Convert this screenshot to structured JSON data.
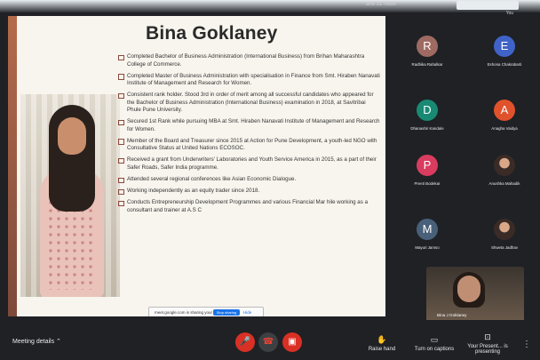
{
  "top": {
    "info": "and 31 more",
    "chip": "",
    "caption": "You"
  },
  "slide": {
    "title": "Bina Goklaney",
    "bullets": [
      "Completed Bachelor of Business Administration (International Business) from Brihan Maharashtra College of Commerce.",
      "Completed Master of Business Administration with specialisation in Finance from Smt. Hiraben Nanavati Institute of Management and Research for Women.",
      "Consistent rank holder. Stood 3rd in order of merit among all successful candidates who appeared for the Bachelor of Business Administration (International Business) examination in 2018, at Savitribai Phule Pune University.",
      "Secured 1st Rank while pursuing MBA at Smt. Hiraben Nanavati Institute of Management and Research for Women.",
      "Member of the Board and Treasurer since 2015 at Action for Pune Development, a youth-led NGO with Consultative Status at United Nations ECOSOC.",
      "Received a grant from Underwriters' Laboratories and Youth Service America in 2015, as a part of their Safer Roads, Safer India programme.",
      "Attended several regional conferences like Asian Economic Dialogue.",
      "Working independently as an equity trader since 2018.",
      "Conducts Entrepreneurship Development Programmes and various Financial Mar                    hile working as a consultant and trainer at A.S C"
    ]
  },
  "share_bar": {
    "text": "meet.google.com is sharing your screen.",
    "stop_label": "Stop sharing",
    "hide_label": "Hide"
  },
  "participants": [
    {
      "name": "Radhika Rahalkar",
      "initial": "R",
      "color": "#9e6a62"
    },
    {
      "name": "Eshona Chakrabarti",
      "initial": "E",
      "color": "#3f63c7"
    },
    {
      "name": "Dhanashri Kandale",
      "initial": "D",
      "color": "#188a73"
    },
    {
      "name": "Anagha Vaidya",
      "initial": "A",
      "color": "#e0522b"
    },
    {
      "name": "Preeti Bodekar",
      "initial": "P",
      "color": "#d93c5f"
    },
    {
      "name": "Anushka Mahadik",
      "initial": "",
      "color": "#3a2b27"
    },
    {
      "name": "Mayuri Jamso",
      "initial": "M",
      "color": "#48607a"
    },
    {
      "name": "Shweta Jadhav",
      "initial": "",
      "color": "#3a2b27"
    }
  ],
  "self": {
    "name": "Bina J Goklaney"
  },
  "bottom": {
    "meeting_details": "Meeting details",
    "raise_hand": "Raise hand",
    "captions": "Turn on captions",
    "present": "Your Present... is presenting"
  }
}
